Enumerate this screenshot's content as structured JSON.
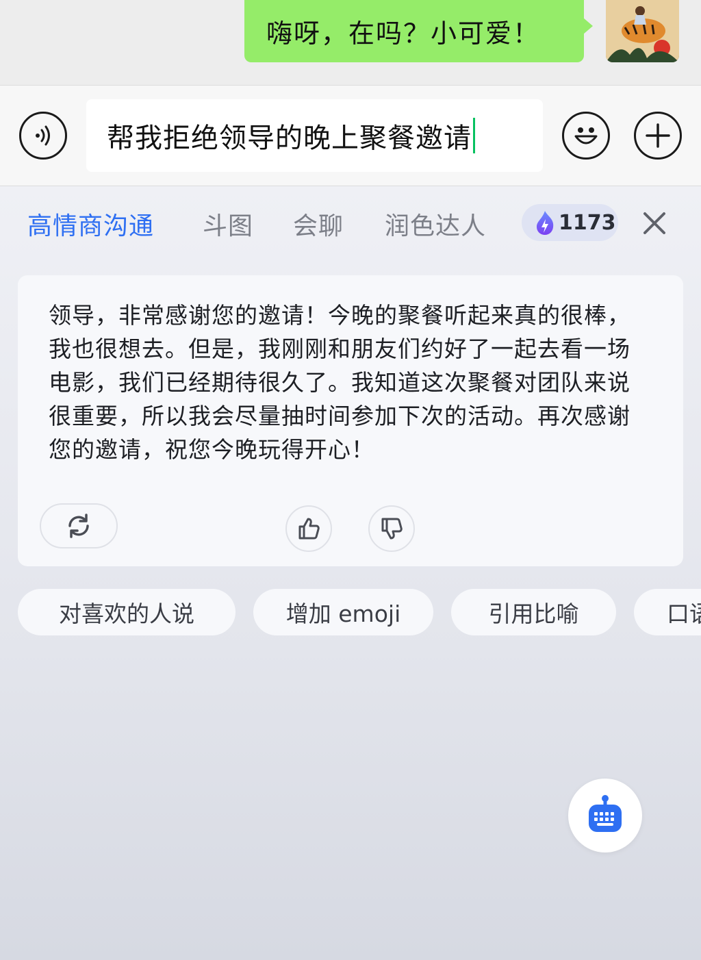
{
  "chat": {
    "message": "嗨呀，在吗？小可爱！"
  },
  "input": {
    "value": "帮我拒绝领导的晚上聚餐邀请"
  },
  "tabs": [
    {
      "label": "高情商沟通",
      "active": true
    },
    {
      "label": "斗图",
      "active": false
    },
    {
      "label": "会聊",
      "active": false
    },
    {
      "label": "润色达人",
      "active": false
    }
  ],
  "points": {
    "value": "1173"
  },
  "reply": {
    "text": "领导，非常感谢您的邀请！今晚的聚餐听起来真的很棒，我也很想去。但是，我刚刚和朋友们约好了一起去看一场电影，我们已经期待很久了。我知道这次聚餐对团队来说很重要，所以我会尽量抽时间参加下次的活动。再次感谢您的邀请，祝您今晚玩得开心！"
  },
  "chips": [
    {
      "label": "对喜欢的人说"
    },
    {
      "label": "增加 emoji"
    },
    {
      "label": "引用比喻"
    },
    {
      "label": "口语"
    }
  ],
  "colors": {
    "accent": "#2e6ff2",
    "bubble": "#95ec69",
    "caret": "#07c160"
  },
  "icons": [
    "voice-icon",
    "emoji-icon",
    "plus-icon",
    "flame-icon",
    "close-icon",
    "refresh-icon",
    "thumbs-up-icon",
    "thumbs-down-icon",
    "keyboard-icon"
  ]
}
